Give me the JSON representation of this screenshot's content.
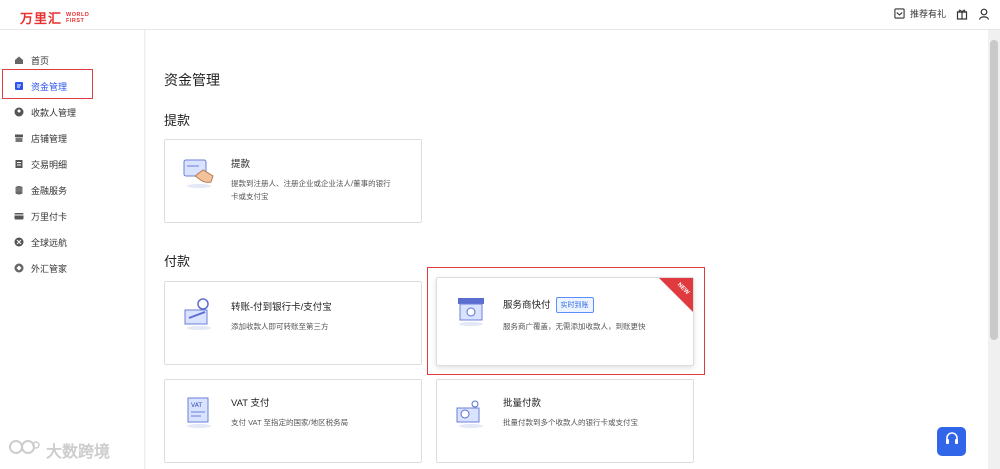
{
  "header": {
    "logo_cn": "万里汇",
    "logo_en_line1": "WORLD",
    "logo_en_line2": "FIRST",
    "invite_label": "推荐有礼",
    "icons": [
      "invite-icon",
      "gift-icon",
      "user-icon"
    ]
  },
  "sidebar": {
    "items": [
      {
        "label": "首页",
        "icon": "home-icon"
      },
      {
        "label": "资金管理",
        "icon": "funds-icon",
        "active": true
      },
      {
        "label": "收款人管理",
        "icon": "payee-icon"
      },
      {
        "label": "店铺管理",
        "icon": "store-icon"
      },
      {
        "label": "交易明细",
        "icon": "transactions-icon"
      },
      {
        "label": "金融服务",
        "icon": "finance-icon"
      },
      {
        "label": "万里付卡",
        "icon": "card-icon"
      },
      {
        "label": "全球远航",
        "icon": "globe-icon"
      },
      {
        "label": "外汇管家",
        "icon": "fx-icon"
      }
    ]
  },
  "main": {
    "title": "资金管理",
    "withdraw_section": "提款",
    "pay_section": "付款",
    "cards": {
      "withdraw": {
        "title": "提款",
        "desc_line1": "提款到注册人、注册企业或企业法人/董事的银行",
        "desc_line2": "卡或支付宝"
      },
      "transfer": {
        "title": "转账-付到银行卡/支付宝",
        "desc": "添加收款人即可转账至第三方"
      },
      "provider": {
        "title": "服务商快付",
        "tag": "实时到账",
        "desc": "服务商广覆盖，无需添加收款人，到账更快",
        "ribbon": "NEW"
      },
      "vat": {
        "title": "VAT 支付",
        "desc": "支付 VAT 至指定的国家/地区税务局"
      },
      "batch": {
        "title": "批量付款",
        "desc": "批量付款到多个收款人的银行卡或支付宝"
      }
    }
  },
  "watermark": {
    "text": "大数跨境"
  },
  "colors": {
    "brand_red": "#e8312f",
    "accent_blue": "#3166e8",
    "highlight": "#e0393e"
  }
}
